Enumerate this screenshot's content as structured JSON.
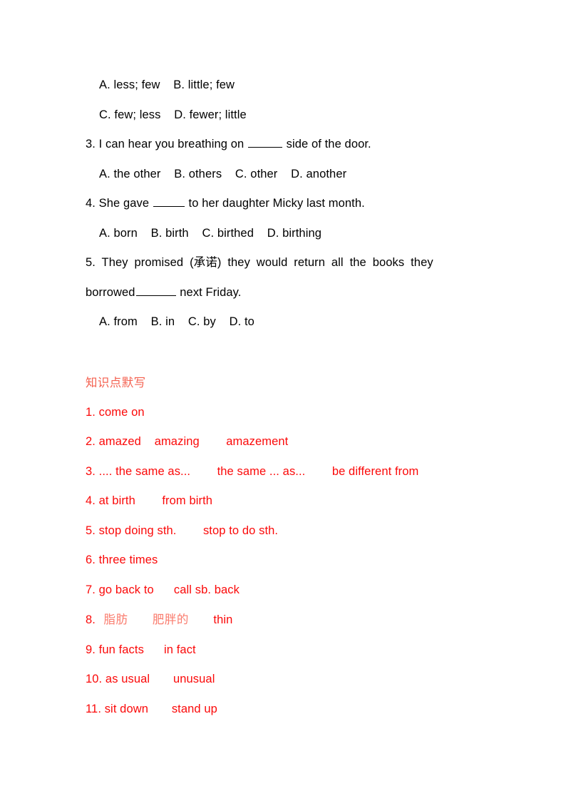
{
  "document": {
    "page_background": "#ffffff",
    "text_color": "#000000",
    "accent_red": "#fb0909",
    "heading_red": "#f4604f"
  },
  "multiple_choice": {
    "q2_options_line1": "A. less; few    B. little; few",
    "q2_options_line2": "C. few; less    D. fewer; little",
    "q3": {
      "number": "3.",
      "text_before_blank": " I can hear you breathing on ",
      "text_after_blank": " side of the door.",
      "options": "A. the other    B. others    C. other    D. another"
    },
    "q4": {
      "number": "4.",
      "text_before_blank": " She gave ",
      "text_after_blank": " to her daughter Micky last month.",
      "options": "A. born    B. birth    C. birthed    D. birthing"
    },
    "q5": {
      "number": "5.",
      "line1": " They promised (承诺) they would return all the books they",
      "line2_before_blank": "borrowed",
      "line2_after_blank": " next Friday.",
      "options": "A. from    B. in    C. by    D. to"
    }
  },
  "dictation": {
    "heading": "知识点默写",
    "items": [
      {
        "number": "1.",
        "segments": [
          {
            "text": " come on",
            "cjk": false
          }
        ]
      },
      {
        "number": "2.",
        "segments": [
          {
            "text": " amazed    amazing        amazement",
            "cjk": false
          }
        ]
      },
      {
        "number": "3.",
        "segments": [
          {
            "text": " .... the same as...        the same ... as...        be different from",
            "cjk": false
          }
        ]
      },
      {
        "number": "4.",
        "segments": [
          {
            "text": " at birth        from birth",
            "cjk": false
          }
        ]
      },
      {
        "number": "5.",
        "segments": [
          {
            "text": " stop doing sth.        stop to do sth.",
            "cjk": false
          }
        ]
      },
      {
        "number": "6.",
        "segments": [
          {
            "text": " three times",
            "cjk": false
          }
        ]
      },
      {
        "number": "7.",
        "segments": [
          {
            "text": " go back to      call sb. back",
            "cjk": false
          }
        ]
      },
      {
        "number": "8.",
        "segments": [
          {
            "text": "  脂肪      肥胖的      ",
            "cjk": true
          },
          {
            "text": "thin",
            "cjk": false
          }
        ]
      },
      {
        "number": "9.",
        "segments": [
          {
            "text": " fun facts      in fact",
            "cjk": false
          }
        ]
      },
      {
        "number": "10.",
        "segments": [
          {
            "text": " as usual       unusual",
            "cjk": false
          }
        ]
      },
      {
        "number": "11.",
        "segments": [
          {
            "text": " sit down       stand up",
            "cjk": false
          }
        ]
      }
    ]
  }
}
